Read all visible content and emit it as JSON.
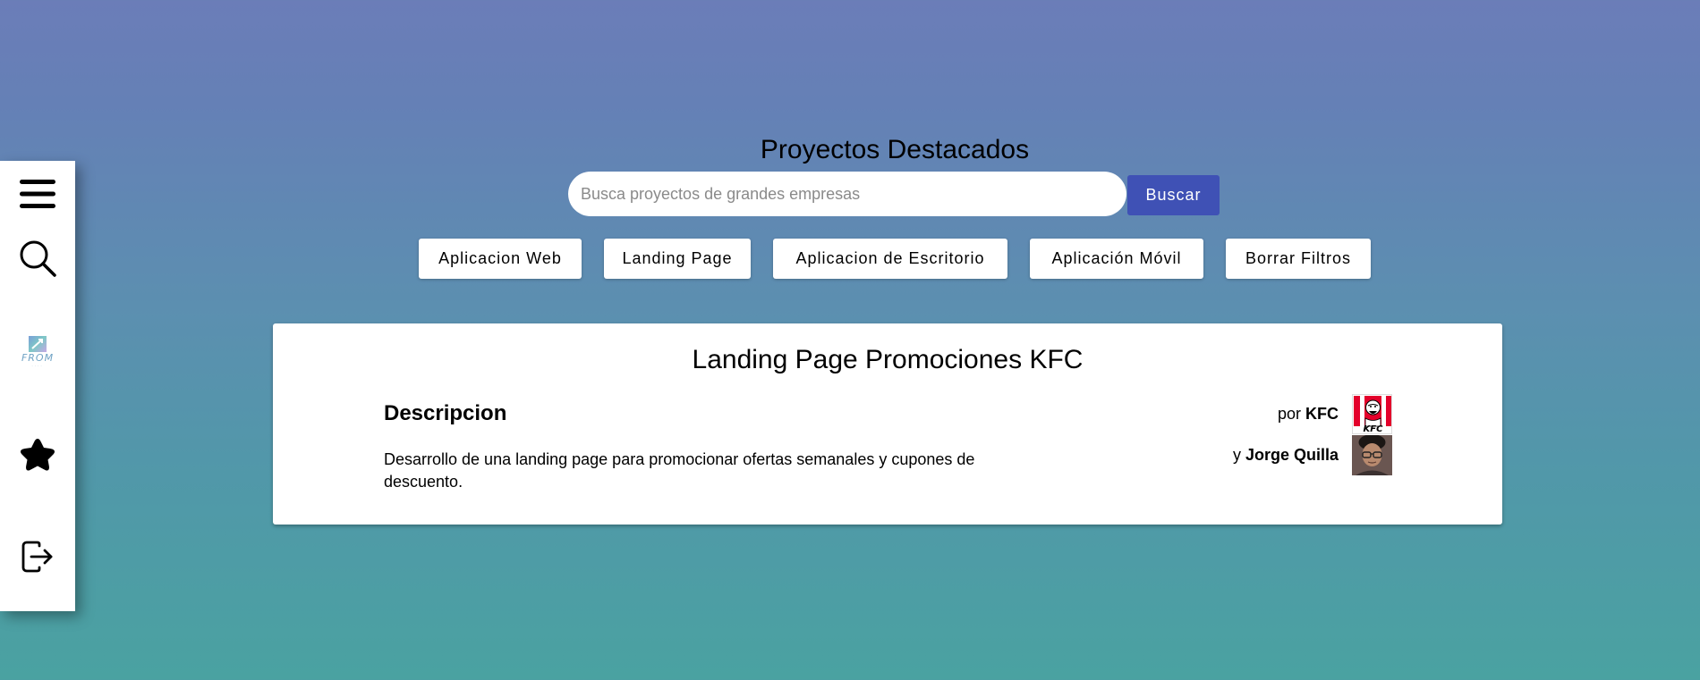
{
  "header": {
    "title": "Proyectos Destacados",
    "search_placeholder": "Busca proyectos de grandes empresas",
    "search_value": "",
    "search_button": "Buscar"
  },
  "filters": [
    {
      "label": "Aplicacion Web"
    },
    {
      "label": "Landing Page"
    },
    {
      "label": "Aplicacion de Escritorio"
    },
    {
      "label": "Aplicación Móvil"
    },
    {
      "label": "Borrar Filtros"
    }
  ],
  "sidebar": {
    "logo_text": "FROM",
    "items": [
      {
        "icon": "menu-icon"
      },
      {
        "icon": "search-icon"
      },
      {
        "icon": "app-logo"
      },
      {
        "icon": "star-icon"
      },
      {
        "icon": "logout-icon"
      }
    ]
  },
  "project": {
    "title": "Landing Page Promociones KFC",
    "description_heading": "Descripcion",
    "description": "Desarrollo de una landing page para promocionar ofertas semanales y cupones de descuento.",
    "by_prefix": "por",
    "company": "KFC",
    "and_prefix": "y",
    "author": "Jorge Quilla",
    "company_logo_text": "KFC"
  },
  "colors": {
    "accent": "#3f51b5",
    "background_top": "#6b7db8",
    "background_bottom": "#4aa2a1"
  }
}
